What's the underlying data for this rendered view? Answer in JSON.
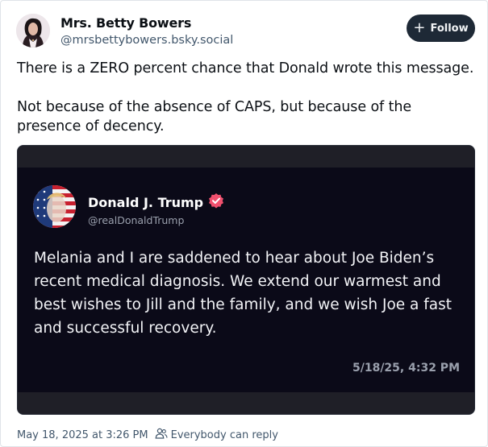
{
  "author": {
    "name": "Mrs. Betty Bowers",
    "handle": "@mrsbettybowers.bsky.social"
  },
  "follow_button": {
    "label": "Follow"
  },
  "post": {
    "paragraphs": [
      "There is a ZERO percent chance that Donald wrote this message.",
      "Not because of the absence of CAPS, but because of the presence of decency."
    ]
  },
  "embed": {
    "name": "Donald J. Trump",
    "handle": "@realDonaldTrump",
    "text": "Melania and I are saddened to hear about Joe Biden’s recent medical diagnosis. We extend our warmest and best wishes to Jill and the family, and we wish Joe a fast and successful recovery.",
    "timestamp": "5/18/25, 4:32 PM",
    "verified_color": "#f0506e"
  },
  "footer": {
    "timestamp": "May 18, 2025 at 3:26 PM",
    "reply_setting": "Everybody can reply"
  },
  "colors": {
    "follow_bg": "#1e2936",
    "embed_bg": "#0b0a18",
    "muted_text": "#42576c"
  }
}
